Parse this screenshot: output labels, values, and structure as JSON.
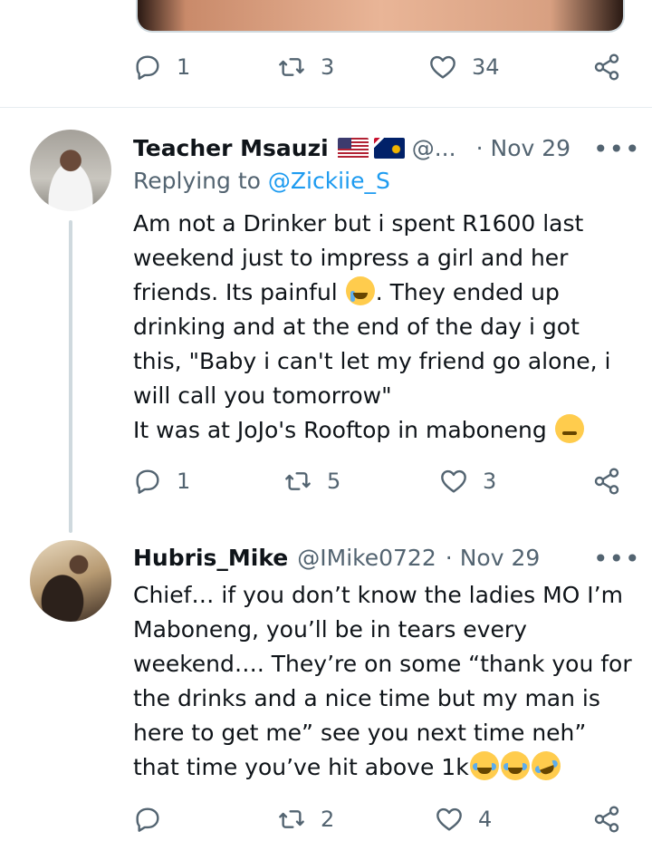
{
  "prev_tweet": {
    "actions": {
      "replies": "1",
      "retweets": "3",
      "likes": "34"
    }
  },
  "tweet1": {
    "name": "Teacher Msauzi",
    "handle": "@...",
    "sep": "·",
    "time": "Nov 29",
    "more": "•••",
    "replying_prefix": "Replying to ",
    "replying_handle": "@Zickiie_S",
    "text_part1": "Am not a Drinker but i spent R1600 last weekend just to impress a girl and her friends. Its painful ",
    "text_part2": ". They ended up drinking and at the end of the day i got this, \"Baby i can't let my friend go alone, i will call you tomorrow\"\nIt was at JoJo's Rooftop in maboneng ",
    "actions": {
      "replies": "1",
      "retweets": "5",
      "likes": "3"
    }
  },
  "tweet2": {
    "name": "Hubris_Mike",
    "handle": "@IMike0722",
    "sep": "·",
    "time": "Nov 29",
    "more": "•••",
    "text": "Chief… if you don’t know the ladies MO I’m Maboneng, you’ll be in tears every weekend…. They’re on some “thank you for the drinks and a nice time but my man is here to get me” see you next time neh” that time you’ve hit above 1k",
    "actions": {
      "retweets": "2",
      "likes": "4"
    }
  },
  "icons": [
    "reply-icon",
    "retweet-icon",
    "like-icon",
    "share-icon",
    "more-icon"
  ],
  "colors": {
    "text": "#0f1419",
    "muted": "#536471",
    "link": "#1d9bf0",
    "divider": "#e6ecf0"
  }
}
